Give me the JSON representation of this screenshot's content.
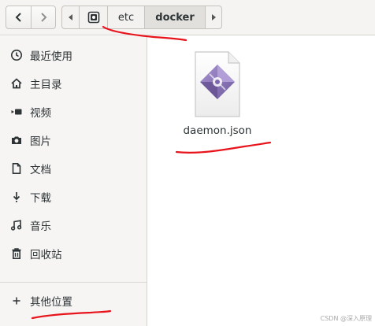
{
  "toolbar": {
    "back_icon": "chevron-left-icon",
    "forward_icon": "chevron-right-icon"
  },
  "pathbar": {
    "root_icon": "drive-icon",
    "segments": [
      "etc",
      "docker"
    ],
    "current": "docker"
  },
  "sidebar": {
    "items": [
      {
        "label": "最近使用",
        "icon": "clock-icon"
      },
      {
        "label": "主目录",
        "icon": "home-icon"
      },
      {
        "label": "视频",
        "icon": "video-icon"
      },
      {
        "label": "图片",
        "icon": "camera-icon"
      },
      {
        "label": "文档",
        "icon": "document-icon"
      },
      {
        "label": "下载",
        "icon": "download-icon"
      },
      {
        "label": "音乐",
        "icon": "music-icon"
      },
      {
        "label": "回收站",
        "icon": "trash-icon"
      },
      {
        "label": "其他位置",
        "icon": "plus-icon"
      }
    ]
  },
  "files": [
    {
      "name": "daemon.json",
      "icon": "json-file-icon"
    }
  ],
  "watermark": "CSDN @深入原理",
  "colors": {
    "annotation": "#e8141c",
    "icon_purple": "#8b76b6"
  }
}
